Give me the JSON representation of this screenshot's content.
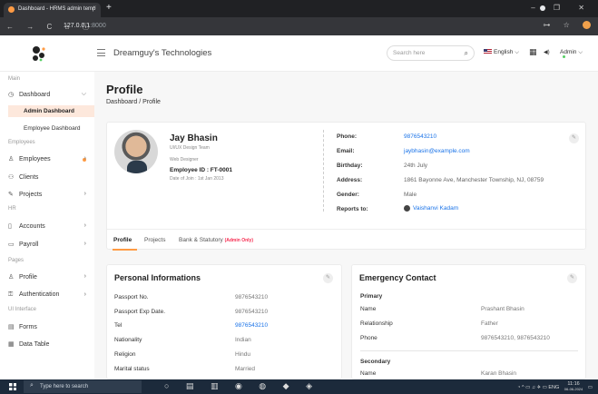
{
  "browser": {
    "tab_title": "Dashboard - HRMS admin temp",
    "tab_close": "×",
    "new_tab": "+",
    "url_host": "127.0.0.1",
    "url_port": ":8000",
    "nav_icons": "← → C ⌂ ⓘ",
    "right_icons": "⊶ ☆",
    "window_controls": "– ❐ ✕"
  },
  "header": {
    "company": "Dreamguy's Technologies",
    "search_placeholder": "Search here",
    "search_icon": "⌕",
    "language": "English",
    "language_chevron": "⌵",
    "calendar_icon": "▦",
    "sound_icon": "◀)",
    "user": "Admin",
    "user_chevron": "⌵"
  },
  "sidebar": {
    "section_main": "Main",
    "dashboard": "Dashboard",
    "admin_dashboard": "Admin Dashboard",
    "employee_dashboard": "Employee Dashboard",
    "section_employees": "Employees",
    "employees": "Employees",
    "clients": "Clients",
    "projects": "Projects",
    "section_hr": "HR",
    "accounts": "Accounts",
    "payroll": "Payroll",
    "section_pages": "Pages",
    "profile": "Profile",
    "authentication": "Authentication",
    "section_ui": "UI Interface",
    "forms": "Forms",
    "data_table": "Data Table",
    "chevron": "›",
    "chevron_down": "⌵",
    "icons": {
      "dashboard": "◷",
      "employees": "♙",
      "clients": "⚇",
      "projects": "✎",
      "accounts": "▯",
      "payroll": "▭",
      "profile": "♙",
      "authentication": "⚿",
      "forms": "▤",
      "data_table": "▦"
    }
  },
  "page": {
    "title": "Profile",
    "breadcrumb": "Dashboard / Profile"
  },
  "profile": {
    "name": "Jay Bhasin",
    "team": "UI/UX Design Team",
    "designation": "Web Designer",
    "employee_id": "Employee ID : FT-0001",
    "date_of_join": "Date of Join : 1st Jan 2013",
    "edit_icon": "✎",
    "details": [
      {
        "label": "Phone:",
        "value": "9876543210",
        "link": true
      },
      {
        "label": "Email:",
        "value": "jaybhasin@example.com",
        "link": true
      },
      {
        "label": "Birthday:",
        "value": "24th July",
        "link": false
      },
      {
        "label": "Address:",
        "value": "1861 Bayonne Ave, Manchester Township, NJ, 08759",
        "link": false
      },
      {
        "label": "Gender:",
        "value": "Male",
        "link": false
      },
      {
        "label": "Reports to:",
        "value": "Vaishanvi Kadam",
        "link": true
      }
    ],
    "tabs": [
      "Profile",
      "Projects",
      "Bank & Statutory"
    ],
    "tab_badge": "(Admin Only)"
  },
  "personal": {
    "title": "Personal Informations",
    "rows": [
      {
        "label": "Passport No.",
        "value": "9876543210"
      },
      {
        "label": "Passport Exp Date.",
        "value": "9876543210"
      },
      {
        "label": "Tel",
        "value": "9876543210"
      },
      {
        "label": "Nationality",
        "value": "Indian"
      },
      {
        "label": "Religion",
        "value": "Hindu"
      },
      {
        "label": "Marital status",
        "value": "Married"
      }
    ]
  },
  "emergency": {
    "title": "Emergency Contact",
    "primary": "Primary",
    "rows": [
      {
        "label": "Name",
        "value": "Prashant Bhasin"
      },
      {
        "label": "Relationship",
        "value": "Father"
      },
      {
        "label": "Phone",
        "value": "9876543210, 9876543210"
      }
    ],
    "secondary": "Secondary",
    "secondary_name_label": "Name",
    "secondary_name_value": "Karan Bhasin"
  },
  "taskbar": {
    "search_text": "Type here to search",
    "search_icon": "⌕",
    "apps": "○ ▤ ▥ ◉ ◍ ◆ ◈",
    "tray": "◔ ^ ▭ ♫ ✈ ▭ ENG",
    "time": "11:16",
    "date": "06-06-2024"
  },
  "colors": {
    "accent": "#ff9b44",
    "link": "#1a73e8",
    "active_bg": "#fde8dc"
  }
}
